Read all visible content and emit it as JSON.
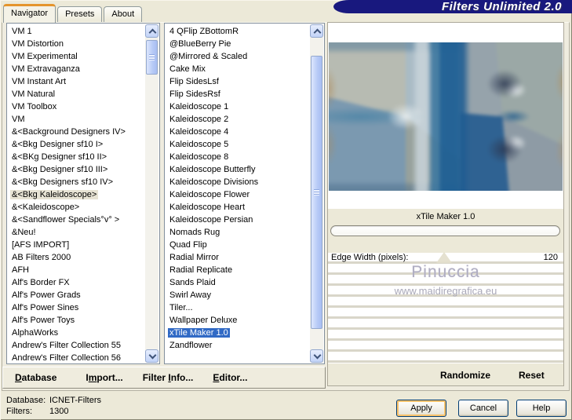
{
  "window": {
    "title": "Filters Unlimited 2.0"
  },
  "tabs": [
    {
      "label": "Navigator",
      "active": true
    },
    {
      "label": "Presets",
      "active": false
    },
    {
      "label": "About",
      "active": false
    }
  ],
  "category_list": {
    "selected_index": 13,
    "items": [
      "VM 1",
      "VM Distortion",
      "VM Experimental",
      "VM Extravaganza",
      "VM Instant Art",
      "VM Natural",
      "VM Toolbox",
      "VM",
      "&<Background Designers IV>",
      "&<Bkg Designer sf10 I>",
      "&<BKg Designer sf10 II>",
      "&<Bkg Designer sf10 III>",
      "&<Bkg Designers sf10 IV>",
      "&<Bkg Kaleidoscope>",
      "&<Kaleidoscope>",
      "&<Sandflower Specials°v° >",
      "&Neu!",
      "[AFS IMPORT]",
      "AB Filters 2000",
      "AFH",
      "Alf's Border FX",
      "Alf's Power Grads",
      "Alf's Power Sines",
      "Alf's Power Toys",
      "AlphaWorks",
      "Andrew's Filter Collection 55",
      "Andrew's Filter Collection 56"
    ]
  },
  "filter_list": {
    "selected_index": 24,
    "items": [
      "4 QFlip ZBottomR",
      "@BlueBerry Pie",
      "@Mirrored & Scaled",
      "Cake Mix",
      "Flip SidesLsf",
      "Flip SidesRsf",
      "Kaleidoscope 1",
      "Kaleidoscope 2",
      "Kaleidoscope 4",
      "Kaleidoscope 5",
      "Kaleidoscope 8",
      "Kaleidoscope Butterfly",
      "Kaleidoscope Divisions",
      "Kaleidoscope Flower",
      "Kaleidoscope Heart",
      "Kaleidoscope Persian",
      "Nomads Rug",
      "Quad Flip",
      "Radial Mirror",
      "Radial Replicate",
      "Sands Plaid",
      "Swirl Away",
      "Tiler...",
      "Wallpaper Deluxe",
      "xTile Maker 1.0",
      "Zandflower"
    ]
  },
  "preview": {
    "selected_filter": "xTile Maker 1.0"
  },
  "parameters": {
    "edge_width": {
      "label": "Edge Width (pixels):",
      "value": "120",
      "slider_position_pct": 46
    }
  },
  "watermark": {
    "name": "Pinuccia",
    "site": "www.maidiregrafica.eu"
  },
  "menu": {
    "items": [
      {
        "pre": "",
        "accel": "D",
        "post": "atabase"
      },
      {
        "pre": "I",
        "accel": "m",
        "post": "port..."
      },
      {
        "pre": "Filter ",
        "accel": "I",
        "post": "nfo..."
      },
      {
        "pre": "",
        "accel": "E",
        "post": "ditor..."
      }
    ]
  },
  "panel_actions": {
    "randomize": "Randomize",
    "reset": "Reset"
  },
  "status": {
    "database_label": "Database:",
    "database_value": "ICNET-Filters",
    "filters_label": "Filters:",
    "filters_value": "1300"
  },
  "buttons": {
    "apply": "Apply",
    "cancel": "Cancel",
    "help": "Help"
  },
  "colors": {
    "title_band": "#18187E",
    "selection_active": "#316AC5",
    "selection_inactive": "#E7E3D4",
    "tab_accent": "#E5942C",
    "dialog_face": "#ECE9D8",
    "focus_ring": "#FBC36B"
  }
}
